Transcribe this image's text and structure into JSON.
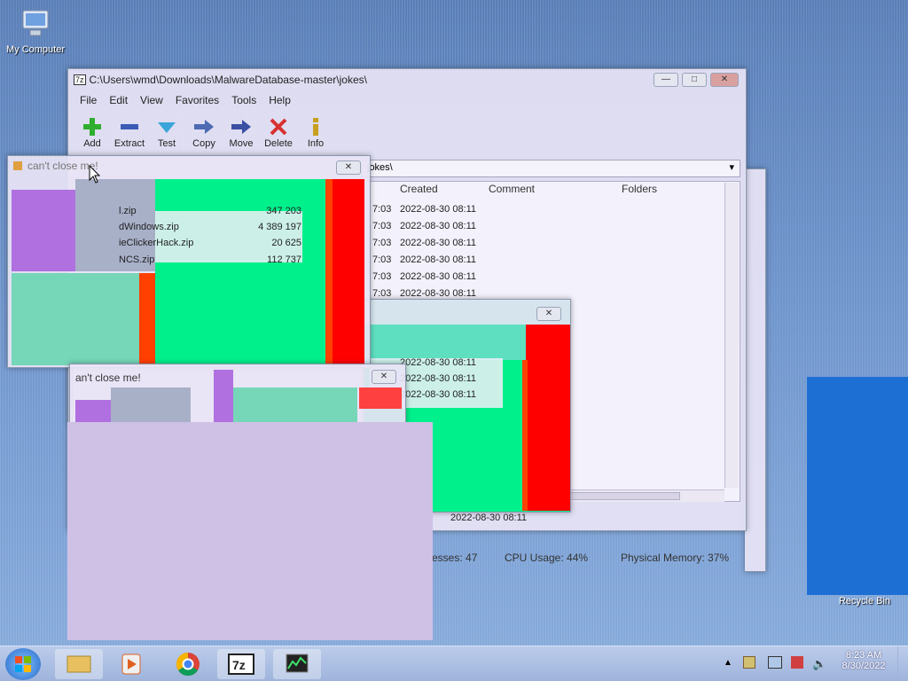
{
  "desktop": {
    "icons": [
      {
        "label": "My Computer",
        "icon": "computer-icon"
      },
      {
        "label": "Recycle Bin",
        "icon": "recycle-bin-icon"
      }
    ]
  },
  "sevenzip": {
    "title": "C:\\Users\\wmd\\Downloads\\MalwareDatabase-master\\jokes\\",
    "app_icon": "7z",
    "menu": [
      "File",
      "Edit",
      "View",
      "Favorites",
      "Tools",
      "Help"
    ],
    "toolbar": [
      {
        "label": "Add",
        "icon": "plus-icon",
        "color": "#2fae2f"
      },
      {
        "label": "Extract",
        "icon": "minus-icon",
        "color": "#3b5bb5"
      },
      {
        "label": "Test",
        "icon": "check-icon",
        "color": "#3aa5d8"
      },
      {
        "label": "Copy",
        "icon": "double-arrow-icon",
        "color": "#4d6ab3"
      },
      {
        "label": "Move",
        "icon": "arrow-right-icon",
        "color": "#3b4fa3"
      },
      {
        "label": "Delete",
        "icon": "x-icon",
        "color": "#d83030"
      },
      {
        "label": "Info",
        "icon": "info-icon",
        "color": "#c8a020"
      }
    ],
    "path_fragment": "jokes\\",
    "columns": [
      "Created",
      "Comment",
      "Folders"
    ],
    "rows": [
      {
        "modified_tail": "7:03",
        "created": "2022-08-30 08:11"
      },
      {
        "modified_tail": "7:03",
        "created": "2022-08-30 08:11"
      },
      {
        "modified_tail": "7:03",
        "created": "2022-08-30 08:11"
      },
      {
        "modified_tail": "7:03",
        "created": "2022-08-30 08:11"
      },
      {
        "modified_tail": "7:03",
        "created": "2022-08-30 08:11"
      },
      {
        "modified_tail": "7:03",
        "created": "2022-08-30 08:11"
      }
    ],
    "extra_rows": [
      "2022-08-30 08:11",
      "2022-08-30 08:11",
      "2022-08-30 08:11"
    ],
    "bottom_date": "2022-08-30 08:11"
  },
  "prank": {
    "title": "can't close me!",
    "title_lower": "an't close me!",
    "files": [
      {
        "name": "l.zip",
        "size": "347 203"
      },
      {
        "name": "dWindows.zip",
        "size": "4 389 197"
      },
      {
        "name": "ieClickerHack.zip",
        "size": "20 625"
      },
      {
        "name": "NCS.zip",
        "size": "112 737"
      }
    ]
  },
  "taskmgr_status": {
    "processes": "esses: 47",
    "cpu": "CPU Usage: 44%",
    "memory": "Physical Memory: 37%"
  },
  "taskbar": {
    "clock_time": "8:23 AM",
    "clock_date": "8/30/2022",
    "items": [
      "explorer-icon",
      "media-player-icon",
      "chrome-icon",
      "7zip-icon",
      "taskmgr-icon"
    ]
  },
  "colors": {
    "green": "#00f08c",
    "red": "#ff0000",
    "orange": "#ff4000",
    "purple": "#b070e0",
    "lavender": "#cfc0e6"
  }
}
